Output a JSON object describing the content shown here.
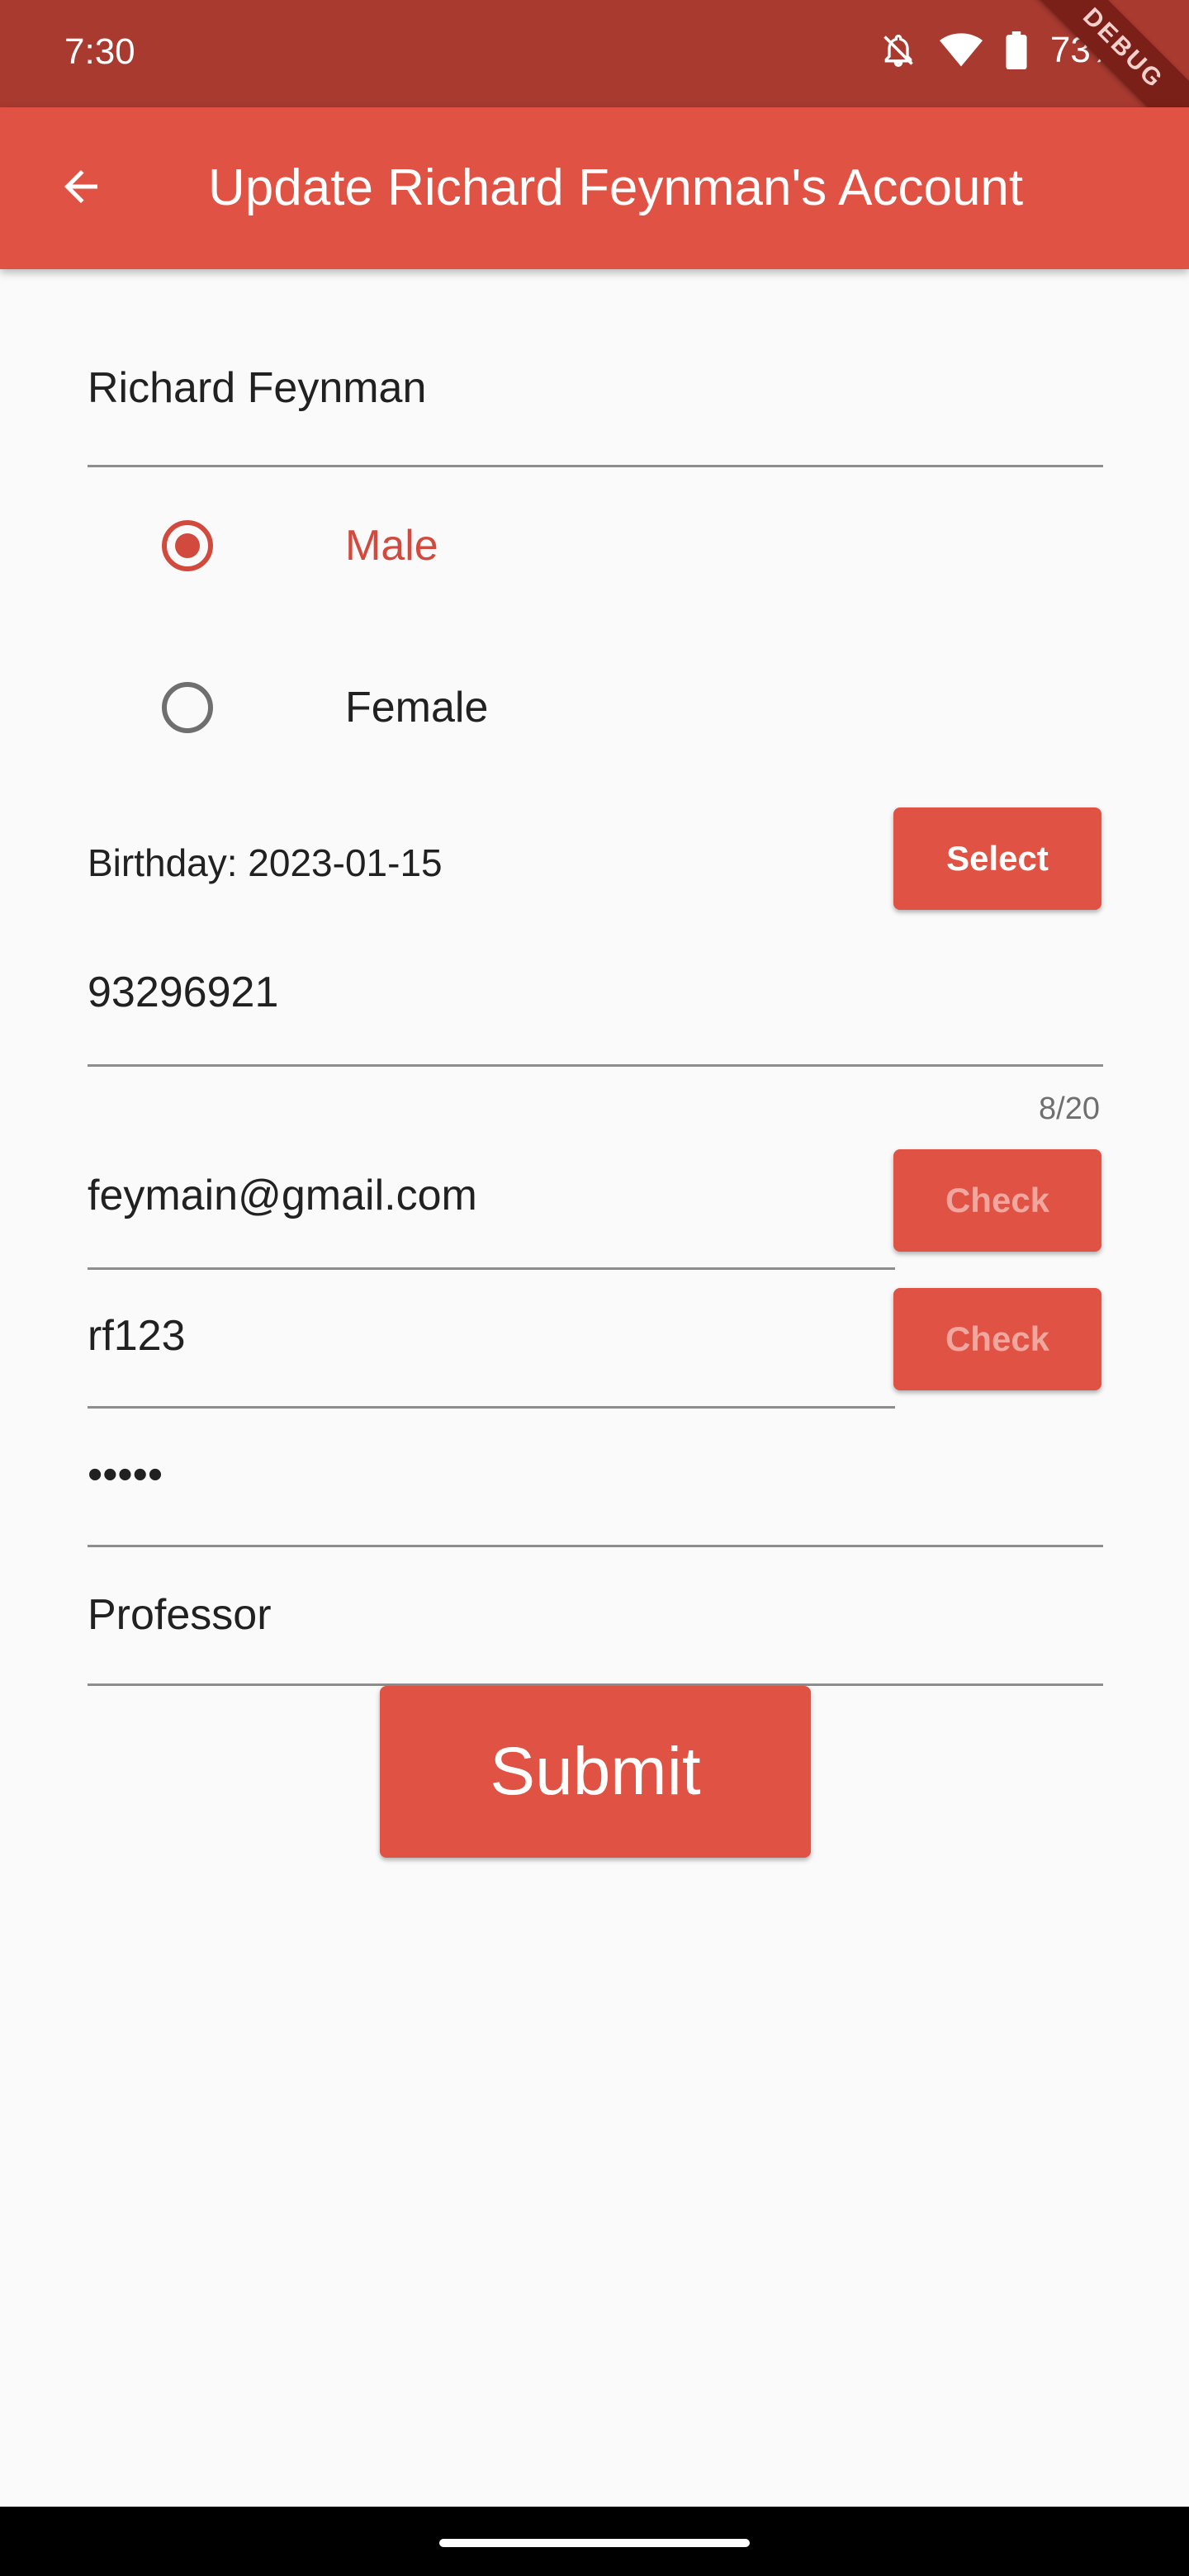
{
  "status_bar": {
    "time": "7:30",
    "battery_percent": "73%",
    "debug_banner": "DEBUG",
    "icons": [
      "notifications-off-icon",
      "wifi-icon",
      "battery-icon"
    ]
  },
  "app_bar": {
    "title": "Update Richard Feynman's Account",
    "back_icon": "arrow-back-icon",
    "color": "#e05243"
  },
  "form": {
    "name_value": "Richard Feynman",
    "gender": {
      "options": [
        {
          "label": "Male",
          "selected": true
        },
        {
          "label": "Female",
          "selected": false
        }
      ]
    },
    "birthday_label": "Birthday: 2023-01-15",
    "select_button": "Select",
    "phone_value": "93296921",
    "phone_counter": "8/20",
    "email_value": "feymain@gmail.com",
    "email_check_button": "Check",
    "username_value": "rf123",
    "username_check_button": "Check",
    "password_value": "•••••",
    "occupation_value": "Professor",
    "submit_button": "Submit"
  },
  "colors": {
    "accent": "#e05243",
    "status_bar": "#a83a30",
    "selected_radio": "#d24a3e",
    "disabled_button_text": "#f0a79f",
    "background": "#fafafa"
  }
}
